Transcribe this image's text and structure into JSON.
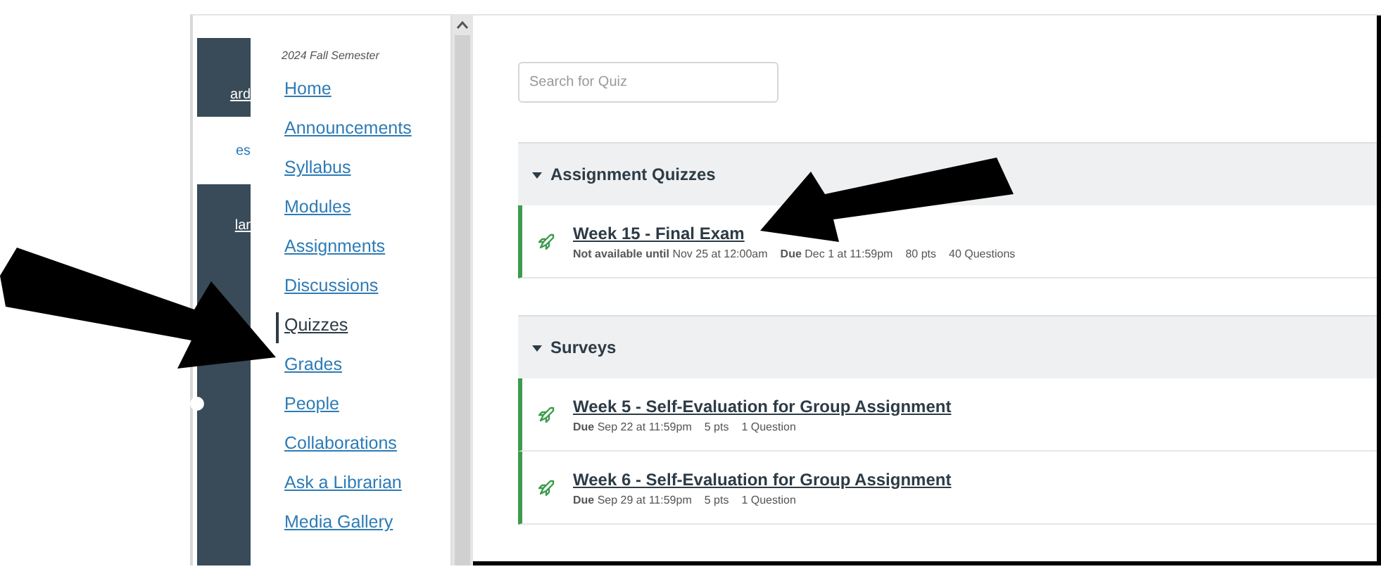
{
  "global_nav": [
    {
      "label": "ard",
      "selected": false
    },
    {
      "label": "es",
      "selected": true
    },
    {
      "label": "lar",
      "selected": false
    }
  ],
  "course_nav": {
    "term": "2024 Fall Semester",
    "items": [
      {
        "label": "Home",
        "selected": false
      },
      {
        "label": "Announcements",
        "selected": false
      },
      {
        "label": "Syllabus",
        "selected": false
      },
      {
        "label": "Modules",
        "selected": false
      },
      {
        "label": "Assignments",
        "selected": false
      },
      {
        "label": "Discussions",
        "selected": false
      },
      {
        "label": "Quizzes",
        "selected": true
      },
      {
        "label": "Grades",
        "selected": false
      },
      {
        "label": "People",
        "selected": false
      },
      {
        "label": "Collaborations",
        "selected": false
      },
      {
        "label": "Ask a Librarian",
        "selected": false
      },
      {
        "label": "Media Gallery",
        "selected": false
      }
    ]
  },
  "search": {
    "placeholder": "Search for Quiz"
  },
  "sections": [
    {
      "title": "Assignment Quizzes",
      "expanded": true,
      "quizzes": [
        {
          "title": "Week 15 - Final Exam",
          "published": true,
          "meta": [
            "**Not available until** Nov 25 at 12:00am",
            "**Due** Dec 1 at 11:59pm",
            "80 pts",
            "40 Questions"
          ]
        }
      ]
    },
    {
      "title": "Surveys",
      "expanded": true,
      "quizzes": [
        {
          "title": "Week 5 - Self-Evaluation for Group Assignment",
          "published": true,
          "meta": [
            "**Due** Sep 22 at 11:59pm",
            "5 pts",
            "1 Question"
          ]
        },
        {
          "title": "Week 6 - Self-Evaluation for Group Assignment",
          "published": true,
          "meta": [
            "**Due** Sep 29 at 11:59pm",
            "5 pts",
            "1 Question"
          ]
        }
      ]
    }
  ]
}
